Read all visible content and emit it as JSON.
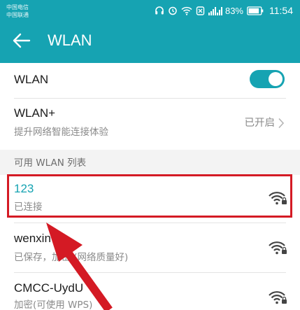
{
  "status_bar": {
    "carrier_1": "中国电信",
    "carrier_2": "中国联通",
    "battery_percent": "83%",
    "time": "11:54",
    "icons": [
      "headset-icon",
      "alarm-icon",
      "wifi-status-icon",
      "silent-icon",
      "signal-icon",
      "battery-icon"
    ]
  },
  "app_bar": {
    "back_icon": "arrow-left-icon",
    "title": "WLAN"
  },
  "settings": {
    "wlan": {
      "label": "WLAN",
      "toggle_on": true
    },
    "wlan_plus": {
      "label": "WLAN+",
      "description": "提升网络智能连接体验",
      "status": "已开启"
    }
  },
  "networks_section": {
    "header": "可用 WLAN 列表",
    "networks": [
      {
        "ssid": "123",
        "status": "已连接",
        "highlighted": true
      },
      {
        "ssid": "wenxin",
        "status": "已保存，加密 (网络质量好)",
        "highlighted": false
      },
      {
        "ssid": "CMCC-UydU",
        "status": "加密(可使用 WPS)",
        "highlighted": false
      }
    ]
  },
  "colors": {
    "accent": "#16a3b2",
    "highlight_border": "#d41a24",
    "arrow": "#d41a24"
  }
}
